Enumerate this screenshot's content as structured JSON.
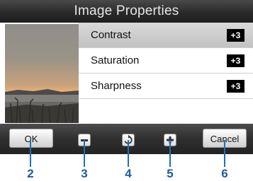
{
  "title": "Image Properties",
  "properties": [
    {
      "label": "Contrast",
      "value": "+3",
      "selected": true
    },
    {
      "label": "Saturation",
      "value": "+3",
      "selected": false
    },
    {
      "label": "Sharpness",
      "value": "+3",
      "selected": false
    }
  ],
  "toolbar": {
    "ok_label": "OK",
    "cancel_label": "Cancel",
    "decrease_icon": "minus-icon",
    "reset_icon": "rotate-icon",
    "increase_icon": "plus-icon"
  },
  "callouts": [
    "2",
    "3",
    "4",
    "5",
    "6"
  ],
  "colors": {
    "callout": "#1f5aa0",
    "title_bar": "#333333",
    "value_badge": "#000000"
  }
}
